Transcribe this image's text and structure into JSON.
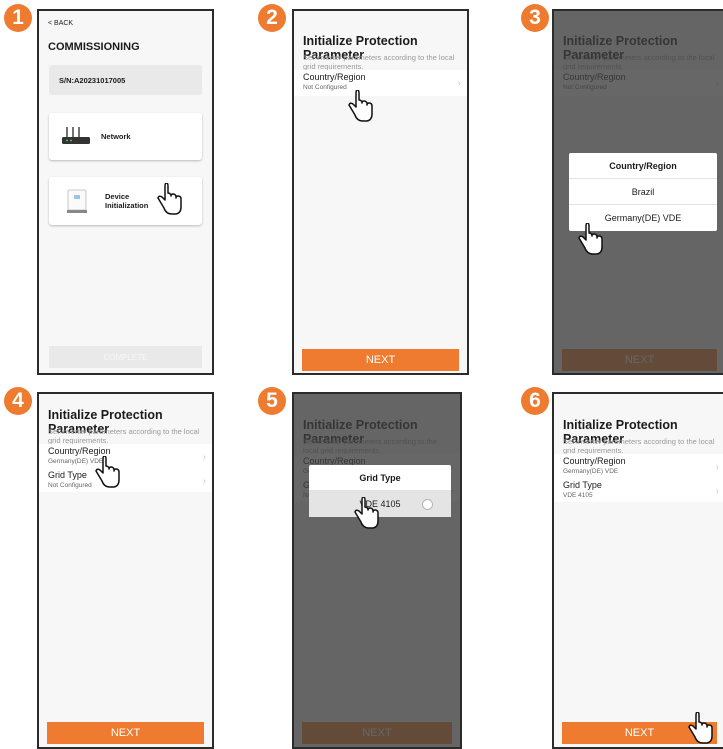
{
  "step_numbers": [
    "1",
    "2",
    "3",
    "4",
    "5",
    "6"
  ],
  "accent_color": "#ee7b30",
  "screen1": {
    "back_label": "< BACK",
    "title": "COMMISSIONING",
    "serial": "S/N:A20231017005",
    "network_label": "Network",
    "device_label_line1": "Device",
    "device_label_line2": "Initialization",
    "complete_label": "COMPLETE"
  },
  "param": {
    "title": "Initialize Protection Parameter",
    "description": "Set inverter parameters according to the local grid requirements.",
    "country_label": "Country/Region",
    "grid_type_label": "Grid Type",
    "not_configured": "Not Configured",
    "country_selected": "Germany(DE) VDE",
    "grid_selected": "VDE 4105",
    "next_label": "NEXT"
  },
  "country_modal": {
    "title": "Country/Region",
    "options": [
      "Brazil",
      "Germany(DE) VDE"
    ]
  },
  "grid_modal": {
    "title": "Grid Type",
    "options": [
      "VDE 4105"
    ]
  }
}
